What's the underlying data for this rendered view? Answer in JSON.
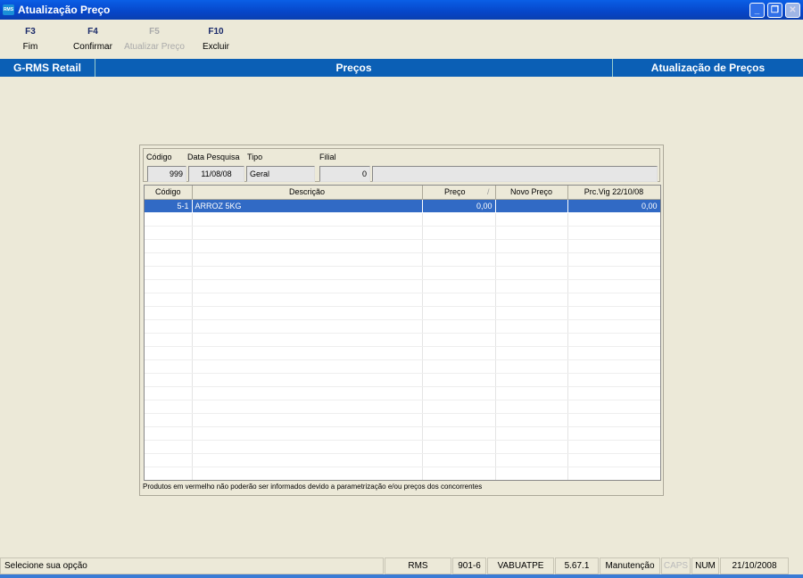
{
  "window": {
    "title": "Atualização Preço",
    "icon": "rms-app-icon"
  },
  "toolbar": [
    {
      "key": "F3",
      "label": "Fim",
      "enabled": true
    },
    {
      "key": "F4",
      "label": "Confirmar",
      "enabled": true
    },
    {
      "key": "F5",
      "label": "Atualizar Preço",
      "enabled": false
    },
    {
      "key": "F10",
      "label": "Excluir",
      "enabled": true
    }
  ],
  "banner": {
    "left": "G-RMS Retail",
    "center": "Preços",
    "right": "Atualização de Preços"
  },
  "form": {
    "codigo_label": "Código",
    "codigo": "999",
    "data_label": "Data Pesquisa",
    "data": "11/08/08",
    "tipo_label": "Tipo",
    "tipo": "Geral",
    "filial_label": "Filial",
    "filial": "0",
    "filial_nome": ""
  },
  "grid": {
    "columns": [
      "Código",
      "Descrição",
      "Preço",
      "Novo Preço",
      "Prc.Vig 22/10/08"
    ],
    "sort_indicator": "/",
    "rows": [
      {
        "codigo": "5-1",
        "descricao": "ARROZ 5KG",
        "preco": "0,00",
        "novo_preco": "",
        "prc_vig": "0,00"
      }
    ]
  },
  "note": "Produtos em vermelho não poderão ser informados devido a parametrização e/ou preços dos concorrentes",
  "statusbar": [
    "Selecione sua opção",
    "RMS",
    "901-6",
    "VABUATPE",
    "5.67.1",
    "Manutenção",
    "CAPS",
    "NUM",
    "21/10/2008"
  ]
}
